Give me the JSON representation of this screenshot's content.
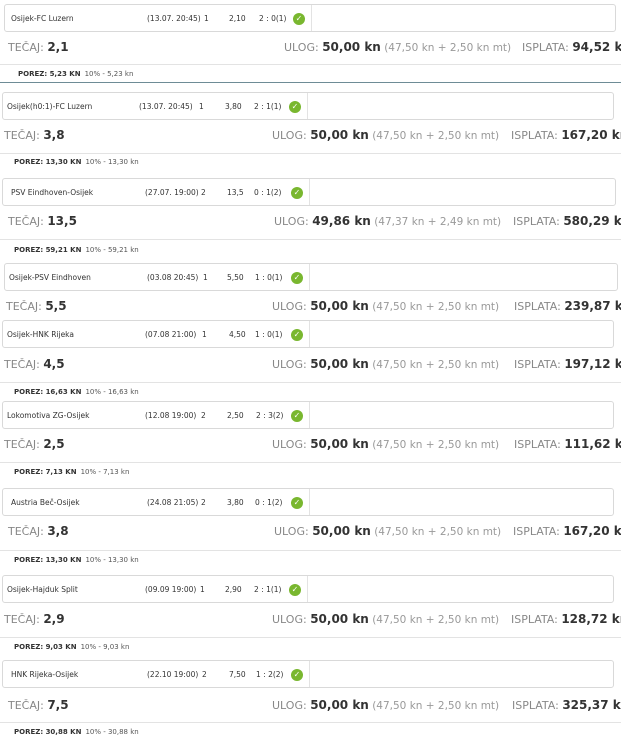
{
  "labels": {
    "odds": "TEČAJ:",
    "stake": "ULOG:",
    "payout": "ISPLATA:",
    "tax": "POREZ:"
  },
  "tickets": [
    {
      "match": "Osijek-FC Luzern",
      "datetime": "(13.07. 20:45)",
      "tip": "1",
      "match_odds": "2,10",
      "result": "2 : 0(1)",
      "total_odds": "2,1",
      "stake": "50,00 kn",
      "stake_detail": "(47,50 kn + 2,50 kn mt)",
      "payout": "94,52 kn",
      "tax": "5,23 KN",
      "tax_detail": "10% - 5,23 kn"
    },
    {
      "match": "Osijek(h0:1)-FC Luzern",
      "datetime": "(13.07. 20:45)",
      "tip": "1",
      "match_odds": "3,80",
      "result": "2 : 1(1)",
      "total_odds": "3,8",
      "stake": "50,00 kn",
      "stake_detail": "(47,50 kn + 2,50 kn mt)",
      "payout": "167,20 kn",
      "tax": "13,30 KN",
      "tax_detail": "10% - 13,30 kn"
    },
    {
      "match": "PSV Eindhoven-Osijek",
      "datetime": "(27.07. 19:00)",
      "tip": "2",
      "match_odds": "13,5",
      "result": "0 : 1(2)",
      "total_odds": "13,5",
      "stake": "49,86 kn",
      "stake_detail": "(47,37 kn + 2,49 kn mt)",
      "payout": "580,29 kn",
      "tax": "59,21 KN",
      "tax_detail": "10% - 59,21 kn"
    },
    {
      "match": "Osijek-PSV Eindhoven",
      "datetime": "(03.08 20:45)",
      "tip": "1",
      "match_odds": "5,50",
      "result": "1 : 0(1)",
      "total_odds": "5,5",
      "stake": "50,00 kn",
      "stake_detail": "(47,50 kn + 2,50 kn mt)",
      "payout": "239,87 kn",
      "tax": "",
      "tax_detail": ""
    },
    {
      "match": "Osijek-HNK Rijeka",
      "datetime": "(07.08 21:00)",
      "tip": "1",
      "match_odds": "4,50",
      "result": "1 : 0(1)",
      "total_odds": "4,5",
      "stake": "50,00 kn",
      "stake_detail": "(47,50 kn + 2,50 kn mt)",
      "payout": "197,12 kn",
      "tax": "16,63 KN",
      "tax_detail": "10% - 16,63 kn"
    },
    {
      "match": "Lokomotiva ZG-Osijek",
      "datetime": "(12.08 19:00)",
      "tip": "2",
      "match_odds": "2,50",
      "result": "2 : 3(2)",
      "total_odds": "2,5",
      "stake": "50,00 kn",
      "stake_detail": "(47,50 kn + 2,50 kn mt)",
      "payout": "111,62 kn",
      "tax": "7,13 KN",
      "tax_detail": "10% - 7,13 kn"
    },
    {
      "match": "Austria Beč-Osijek",
      "datetime": "(24.08 21:05)",
      "tip": "2",
      "match_odds": "3,80",
      "result": "0 : 1(2)",
      "total_odds": "3,8",
      "stake": "50,00 kn",
      "stake_detail": "(47,50 kn + 2,50 kn mt)",
      "payout": "167,20 kn",
      "tax": "13,30 KN",
      "tax_detail": "10% - 13,30 kn"
    },
    {
      "match": "Osijek-Hajduk Split",
      "datetime": "(09.09 19:00)",
      "tip": "1",
      "match_odds": "2,90",
      "result": "2 : 1(1)",
      "total_odds": "2,9",
      "stake": "50,00 kn",
      "stake_detail": "(47,50 kn + 2,50 kn mt)",
      "payout": "128,72 kn",
      "tax": "9,03 KN",
      "tax_detail": "10% - 9,03 kn"
    },
    {
      "match": "HNK Rijeka-Osijek",
      "datetime": "(22.10 19:00)",
      "tip": "2",
      "match_odds": "7,50",
      "result": "1 : 2(2)",
      "total_odds": "7,5",
      "stake": "50,00 kn",
      "stake_detail": "(47,50 kn + 2,50 kn mt)",
      "payout": "325,37 kn",
      "tax": "30,88 KN",
      "tax_detail": "10% - 30,88 kn"
    }
  ]
}
